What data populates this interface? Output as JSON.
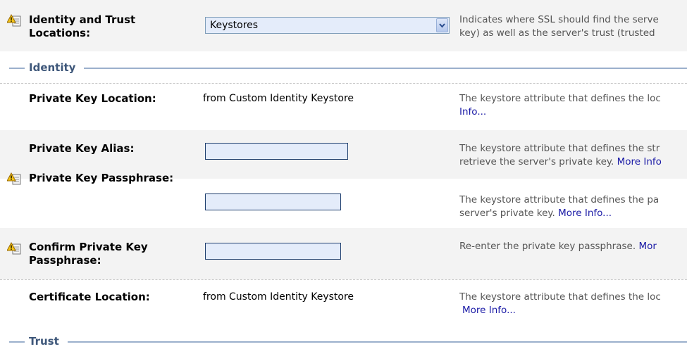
{
  "identity_trust": {
    "label": "Identity and Trust Locations:",
    "selected": "Keystores",
    "desc_line1": "Indicates where SSL should find the serve",
    "desc_line2": "key) as well as the server's trust (trusted"
  },
  "sections": {
    "identity": "Identity",
    "trust": "Trust"
  },
  "rows": {
    "private_key_location": {
      "label": "Private Key Location:",
      "value": "from Custom Identity Keystore",
      "desc_line1": "The keystore attribute that defines the loc",
      "link": "Info..."
    },
    "private_key_alias": {
      "label": "Private Key Alias:",
      "value": "",
      "desc_line1": "The keystore attribute that defines the str",
      "desc_line2_text": "retrieve the server's private key. ",
      "link": "More Info"
    },
    "private_key_passphrase": {
      "label": "Private Key Passphrase:",
      "value": "",
      "desc_line1": "The keystore attribute that defines the pa",
      "desc_line2_text": "server's private key. ",
      "link": "More Info..."
    },
    "confirm_passphrase": {
      "label_line1": "Confirm Private Key",
      "label_line2": "Passphrase:",
      "value": "",
      "desc_line1_text": "Re-enter the private key passphrase. ",
      "link": "Mor"
    },
    "certificate_location": {
      "label": "Certificate Location:",
      "value": "from Custom Identity Keystore",
      "desc_line1": "The keystore attribute that defines the loc",
      "link": "More Info..."
    }
  },
  "icons": {
    "warning": "config-warning-icon",
    "dropdown": "chevron-down-icon"
  },
  "colors": {
    "row_shade": "#f3f3f3",
    "section_line": "#9bb0cc",
    "link": "#1a1aa6",
    "input_bg": "#e4ecfa"
  }
}
